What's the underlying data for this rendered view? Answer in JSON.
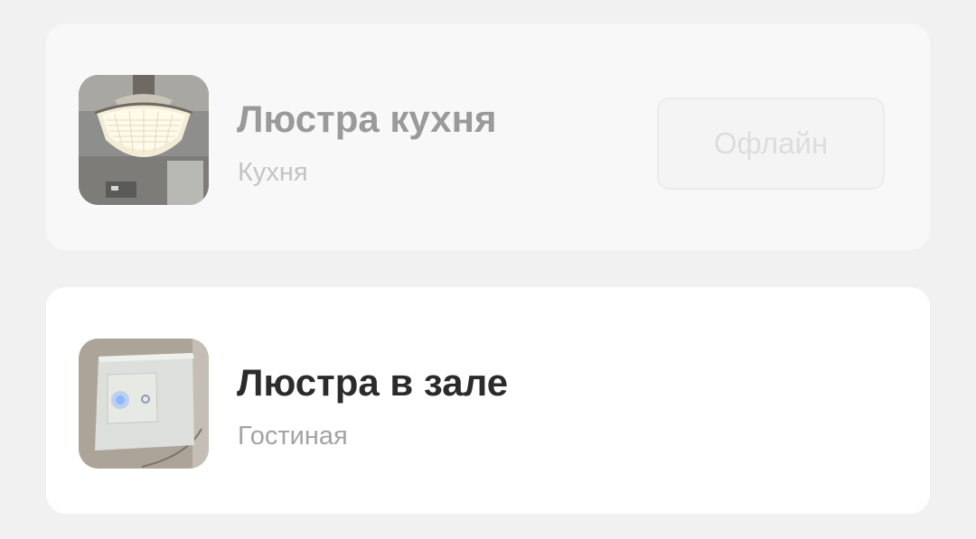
{
  "devices": [
    {
      "name": "Люстра кухня",
      "room": "Кухня",
      "status_label": "Офлайн",
      "state": "offline",
      "thumbnail_icon": "chandelier-photo"
    },
    {
      "name": "Люстра в зале",
      "room": "Гостиная",
      "state": "online",
      "thumbnail_icon": "wall-switch-photo"
    }
  ],
  "colors": {
    "background": "#f1f1f1",
    "card_online": "#ffffff",
    "card_offline": "#f8f8f8",
    "title_online": "#2b2b2b",
    "title_offline": "#9a9a9a"
  }
}
